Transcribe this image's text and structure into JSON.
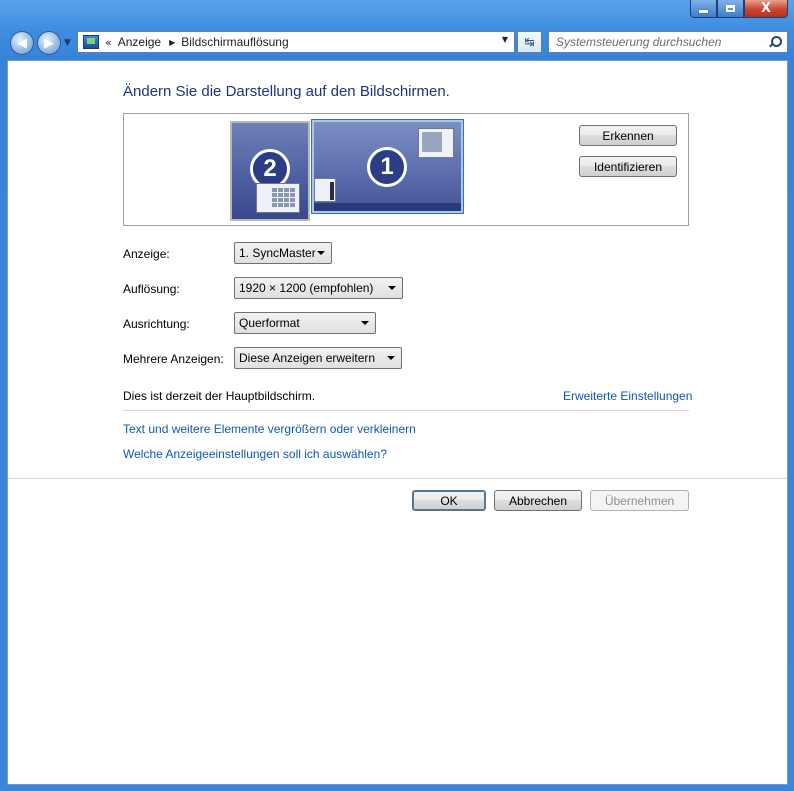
{
  "window": {
    "caption_buttons": [
      "minimize-icon",
      "maximize-icon",
      "close-icon"
    ],
    "close_glyph": "X"
  },
  "nav": {
    "back_icon": "back-arrow-icon",
    "forward_icon": "forward-arrow-icon",
    "address_chevron": "«",
    "breadcrumb": [
      "Anzeige",
      "Bildschirmauflösung"
    ],
    "search_placeholder": "Systemsteuerung durchsuchen"
  },
  "main": {
    "title": "Ändern Sie die Darstellung auf den Bildschirmen.",
    "monitors": [
      {
        "number": "2"
      },
      {
        "number": "1"
      }
    ],
    "detect_button": "Erkennen",
    "identify_button": "Identifizieren",
    "fields": {
      "display_label": "Anzeige:",
      "display_value": "1. SyncMaster",
      "resolution_label": "Auflösung:",
      "resolution_value": "1920 × 1200 (empfohlen)",
      "orientation_label": "Ausrichtung:",
      "orientation_value": "Querformat",
      "multiple_label": "Mehrere Anzeigen:",
      "multiple_value": "Diese Anzeigen erweitern"
    },
    "status_text": "Dies ist derzeit der Hauptbildschirm.",
    "advanced_link": "Erweiterte Einstellungen",
    "links": [
      "Text und weitere Elemente vergrößern oder verkleinern",
      "Welche Anzeigeeinstellungen soll ich auswählen?"
    ],
    "ok_button": "OK",
    "cancel_button": "Abbrechen",
    "apply_button": "Übernehmen"
  },
  "colors": {
    "title": "#1e3287",
    "link": "#0f59b5",
    "frame": "#3f8ee0"
  }
}
